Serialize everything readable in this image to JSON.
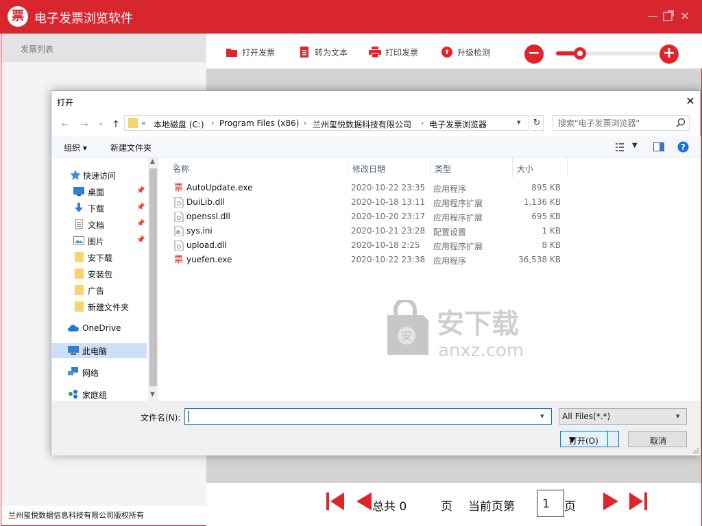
{
  "app": {
    "logo_char": "票",
    "title": "电子发票浏览软件"
  },
  "sidebar": {
    "header": "发票列表"
  },
  "toolbar": {
    "open": "打开发票",
    "to_text": "转为文本",
    "print": "打印发票",
    "upgrade": "升级检测",
    "zoom_level": 0.2
  },
  "pager": {
    "total_label": "总共",
    "total_value": "0",
    "page_suffix": "页",
    "current_label": "当前页第",
    "current_value": "1",
    "current_suffix": "页"
  },
  "copyright": "兰州玺悦数据信息科技有限公司版权所有",
  "dialog": {
    "title": "打开",
    "address": {
      "prefix": "«",
      "segments": [
        "本地磁盘 (C:)",
        "Program Files (x86)",
        "兰州玺悦数据科技有限公司",
        "电子发票浏览器"
      ]
    },
    "search_placeholder": "搜索\"电子发票浏览器\"",
    "commands": {
      "organize": "组织 ▾",
      "new_folder": "新建文件夹"
    },
    "nav": {
      "quick_access": "快速访问",
      "items": [
        "桌面",
        "下载",
        "文档",
        "图片",
        "安下载",
        "安装包",
        "广告",
        "新建文件夹"
      ],
      "onedrive": "OneDrive",
      "this_pc": "此电脑",
      "network": "网络",
      "homegroup": "家庭组"
    },
    "columns": {
      "name": "名称",
      "date": "修改日期",
      "type": "类型",
      "size": "大小"
    },
    "files": [
      {
        "name": "AutoUpdate.exe",
        "date": "2020-10-22 23:35",
        "type": "应用程序",
        "size": "895 KB",
        "icon": "invoice-app-icon"
      },
      {
        "name": "DuiLib.dll",
        "date": "2020-10-18 13:11",
        "type": "应用程序扩展",
        "size": "1,136 KB",
        "icon": "dll-file-icon"
      },
      {
        "name": "openssl.dll",
        "date": "2020-10-20 23:17",
        "type": "应用程序扩展",
        "size": "695 KB",
        "icon": "dll-file-icon"
      },
      {
        "name": "sys.ini",
        "date": "2020-10-21 23:28",
        "type": "配置设置",
        "size": "1 KB",
        "icon": "ini-file-icon"
      },
      {
        "name": "upload.dll",
        "date": "2020-10-18 2:25",
        "type": "应用程序扩展",
        "size": "8 KB",
        "icon": "dll-file-icon"
      },
      {
        "name": "yuefen.exe",
        "date": "2020-10-22 23:38",
        "type": "应用程序",
        "size": "36,538 KB",
        "icon": "invoice-app-icon"
      }
    ],
    "filename_label": "文件名(N):",
    "filename_value": "",
    "filter": "All Files(*.*)",
    "open_button": "打开(O)",
    "cancel_button": "取消"
  },
  "watermark": {
    "cn": "安下载",
    "en": "anxz.com"
  },
  "colors": {
    "brand_red": "#d7262e",
    "accent_blue": "#0078d7"
  }
}
